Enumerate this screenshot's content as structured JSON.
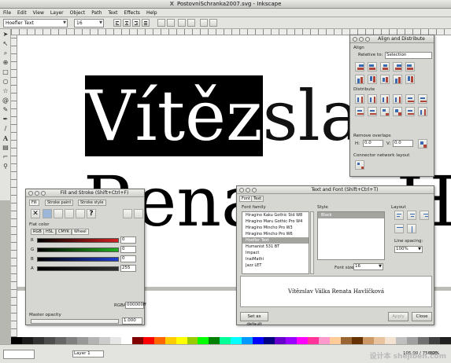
{
  "window": {
    "title": "PostovniSchranka2007.svg - Inkscape",
    "close_glyph": "X"
  },
  "menu": [
    "File",
    "Edit",
    "View",
    "Layer",
    "Object",
    "Path",
    "Text",
    "Effects",
    "Help"
  ],
  "toolbar": {
    "font_family": "Hoefler Text",
    "font_size": "16"
  },
  "canvas": {
    "line1_selected": "Vítěz",
    "line1_rest": "slav",
    "line2": "Rena",
    "line2_tail": "Ha"
  },
  "align": {
    "title": "Align and Distribute",
    "align_label": "Align",
    "relative_label": "Relative to:",
    "relative_value": "Selection",
    "distribute_label": "Distribute",
    "remove_overlaps": "Remove overlaps",
    "h_label": "H:",
    "h_value": "0.0",
    "v_label": "V:",
    "v_value": "0.0",
    "connector_label": "Connector network layout"
  },
  "fill": {
    "title": "Fill and Stroke (Shift+Ctrl+F)",
    "tabs": [
      "Fill",
      "Stroke paint",
      "Stroke style"
    ],
    "flat_color": "Flat color",
    "modes": [
      "RGB",
      "HSL",
      "CMYK",
      "Wheel"
    ],
    "channels": [
      {
        "label": "R",
        "value": "0",
        "color": "#d22020"
      },
      {
        "label": "G",
        "value": "0",
        "color": "#20b020"
      },
      {
        "label": "B",
        "value": "0",
        "color": "#2040d0"
      },
      {
        "label": "A",
        "value": "255",
        "color": "#303030"
      }
    ],
    "rgba_label": "RGBA:",
    "rgba_value": "000000ff",
    "opacity_label": "Master opacity",
    "opacity_value": "1.000"
  },
  "textfont": {
    "title": "Text and Font (Shift+Ctrl+T)",
    "tabs": [
      "Font",
      "Text"
    ],
    "family_label": "Font family",
    "families": [
      "Hiragino Kaku Gothic Std W8",
      "Hiragino Maru Gothic Pro W4",
      "Hiragino Mincho Pro W3",
      "Hiragino Mincho Pro W6",
      "Hoefler Text",
      "Humanist 531 BT",
      "Impact",
      "InaiMathi",
      "Jazz LET"
    ],
    "selected_family": "Hoefler Text",
    "style_label": "Style",
    "style_value": "Black",
    "size_label": "Font size:",
    "size_value": "16",
    "layout_label": "Layout",
    "spacing_label": "Line spacing:",
    "spacing_value": "100%",
    "preview": "Vítězslav Válka Renata Havlíčková",
    "default_btn": "Set as default",
    "apply_btn": "Apply",
    "close_btn": "Close"
  },
  "status": {
    "layer": "Layer 1",
    "coords": "105.00 / 756.00",
    "zoom": "82%"
  },
  "watermark": "设计本 shejiben.com",
  "palette": [
    "#000000",
    "#1a1a1a",
    "#333333",
    "#4d4d4d",
    "#666666",
    "#808080",
    "#999999",
    "#b3b3b3",
    "#cccccc",
    "#e6e6e6",
    "#ffffff",
    "#800000",
    "#ff0000",
    "#ff6600",
    "#ffcc00",
    "#ffff00",
    "#99cc00",
    "#00ff00",
    "#008000",
    "#00ff99",
    "#00ffff",
    "#0099ff",
    "#0000ff",
    "#000080",
    "#6600cc",
    "#9900ff",
    "#ff00ff",
    "#ff3399",
    "#ff99cc",
    "#ffcc99",
    "#996633",
    "#663300",
    "#cc9966",
    "#e8c39e",
    "#f4e2d0",
    "#c0c0c0",
    "#a0a0a0",
    "#707070",
    "#404040",
    "#202020"
  ]
}
